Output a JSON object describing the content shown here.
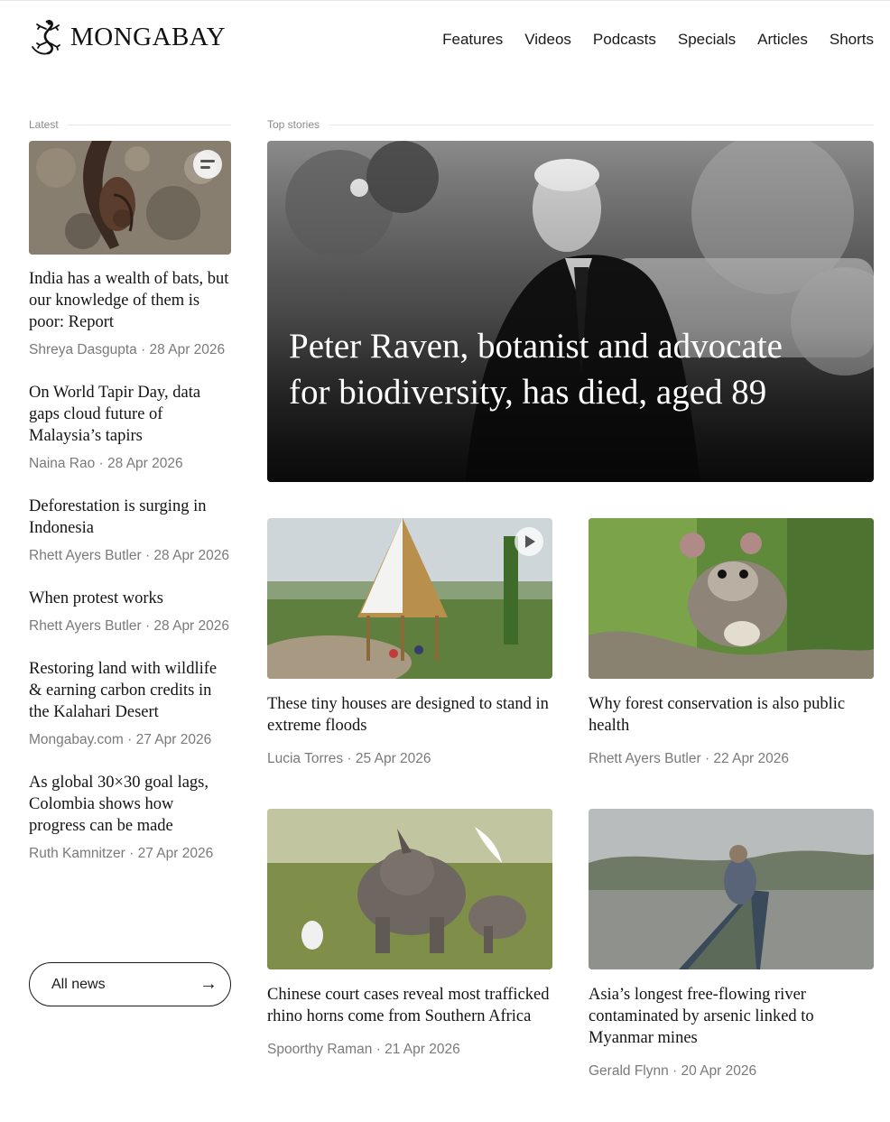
{
  "brand": {
    "name": "MONGABAY",
    "logo_icon": "gecko-icon"
  },
  "nav": [
    {
      "label": "Features"
    },
    {
      "label": "Videos"
    },
    {
      "label": "Podcasts"
    },
    {
      "label": "Specials"
    },
    {
      "label": "Articles"
    },
    {
      "label": "Shorts"
    }
  ],
  "sections": {
    "latest": "Latest",
    "top": "Top stories"
  },
  "latest": [
    {
      "headline": "India has a wealth of bats, but our knowledge of them is poor: Report",
      "meta": "Shreya Dasgupta · 28 Apr 2026",
      "badge_icon": "article-menu-icon"
    },
    {
      "headline": "On World Tapir Day, data gaps cloud future of Malaysia’s tapirs",
      "meta": "Naina Rao · 28 Apr 2026"
    },
    {
      "headline": "Deforestation is surging in Indonesia",
      "meta": "Rhett Ayers Butler · 28 Apr 2026"
    },
    {
      "headline": "When protest works",
      "meta": "Rhett Ayers Butler · 28 Apr 2026"
    },
    {
      "headline": "Restoring land with wildlife & earning carbon credits in the Kalahari Desert",
      "meta": "Mongabay.com · 27 Apr 2026"
    },
    {
      "headline": "As global 30×30 goal lags, Colombia shows how progress can be made",
      "meta": "Ruth Kamnitzer · 27 Apr 2026"
    }
  ],
  "all_news": {
    "label": "All news",
    "icon": "arrow-right-icon"
  },
  "hero": {
    "headline": "Peter Raven, botanist and advocate for biodiversity, has died, aged 89"
  },
  "cards": [
    {
      "headline": "These tiny houses are designed to stand in extreme floods",
      "meta": "Lucia Torres · 25 Apr 2026",
      "badge_icon": "play-icon"
    },
    {
      "headline": "Why forest conservation is also public health",
      "meta": "Rhett Ayers Butler · 22 Apr 2026"
    },
    {
      "headline": "Chinese court cases reveal most trafficked rhino horns come from Southern Africa",
      "meta": "Spoorthy Raman · 21 Apr 2026"
    },
    {
      "headline": "Asia’s longest free-flowing river contaminated by arsenic linked to Myanmar mines",
      "meta": "Gerald Flynn · 20 Apr 2026"
    }
  ],
  "colors": {
    "text": "#1a1a1a",
    "meta": "#7a7a7a",
    "rule": "#e8e8e8"
  }
}
